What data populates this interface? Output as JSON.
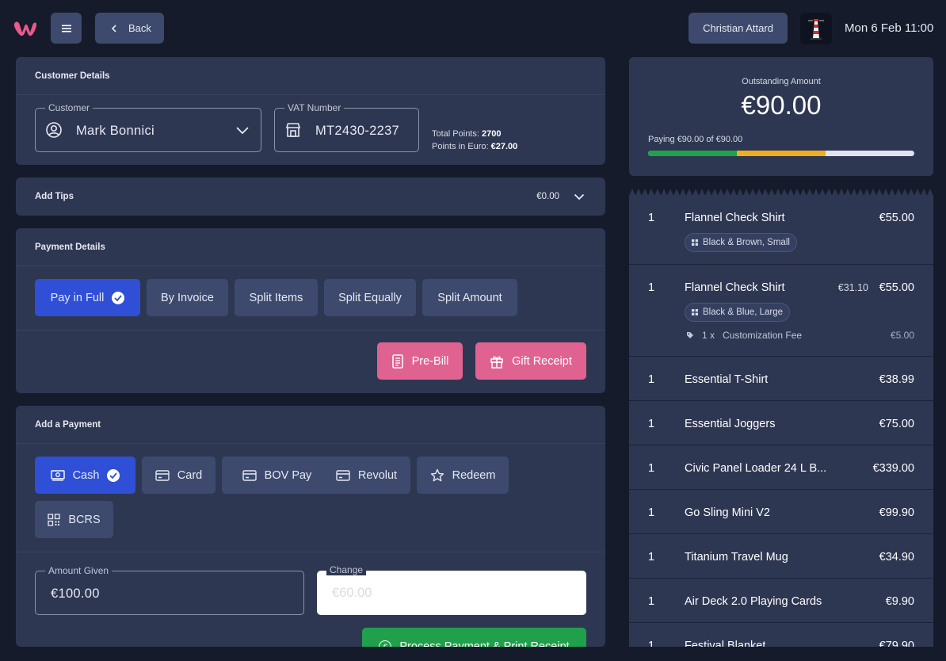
{
  "header": {
    "back_label": "Back",
    "user_name": "Christian Attard",
    "datetime": "Mon 6 Feb 11:00"
  },
  "customer_details": {
    "title": "Customer Details",
    "customer_legend": "Customer",
    "customer_value": "Mark Bonnici",
    "vat_legend": "VAT Number",
    "vat_value": "MT2430-2237",
    "total_points_label": "Total Points:",
    "total_points_value": "2700",
    "points_euro_label": "Points in Euro:",
    "points_euro_value": "€27.00"
  },
  "tips": {
    "title": "Add Tips",
    "value": "€0.00"
  },
  "payment_details": {
    "title": "Payment Details",
    "options": [
      "Pay in Full",
      "By Invoice",
      "Split Items",
      "Split Equally",
      "Split Amount"
    ],
    "selected": "Pay in Full",
    "prebill_label": "Pre-Bill",
    "gift_receipt_label": "Gift Receipt"
  },
  "add_payment": {
    "title": "Add a Payment",
    "methods": [
      "Cash",
      "Card",
      "BOV Pay",
      "Revolut",
      "Redeem",
      "BCRS"
    ],
    "selected": "Cash",
    "amount_given_legend": "Amount Given",
    "amount_given_value": "€100.00",
    "change_legend": "Change",
    "change_placeholder": "€60.00",
    "process_label": "Process Payment & Print Receipt"
  },
  "summary": {
    "outstanding_label": "Outstanding Amount",
    "outstanding_amount": "€90.00",
    "paying_text": "Paying €90.00 of €90.00",
    "progress_fraction": 1.0
  },
  "items": [
    {
      "qty": "1",
      "name": "Flannel Check Shirt",
      "price": "€55.00",
      "variant": "Black & Brown, Small"
    },
    {
      "qty": "1",
      "name": "Flannel Check Shirt",
      "old_price": "€31.10",
      "price": "€55.00",
      "variant": "Black & Blue, Large",
      "fee_qty": "1 x",
      "fee_name": "Customization Fee",
      "fee_price": "€5.00"
    },
    {
      "qty": "1",
      "name": "Essential T-Shirt",
      "price": "€38.99"
    },
    {
      "qty": "1",
      "name": "Essential Joggers",
      "price": "€75.00"
    },
    {
      "qty": "1",
      "name": "Civic Panel Loader 24 L B...",
      "price": "€339.00"
    },
    {
      "qty": "1",
      "name": "Go Sling Mini V2",
      "price": "€99.90"
    },
    {
      "qty": "1",
      "name": "Titanium Travel Mug",
      "price": "€34.90"
    },
    {
      "qty": "1",
      "name": "Air Deck 2.0 Playing Cards",
      "price": "€9.90"
    },
    {
      "qty": "1",
      "name": "Festival Blanket",
      "price": "€79.90"
    }
  ],
  "colors": {
    "accent_blue": "#2f4fd6",
    "pink": "#e06290",
    "green": "#20a04c",
    "panel": "#2e3752",
    "background": "#161b2b"
  }
}
